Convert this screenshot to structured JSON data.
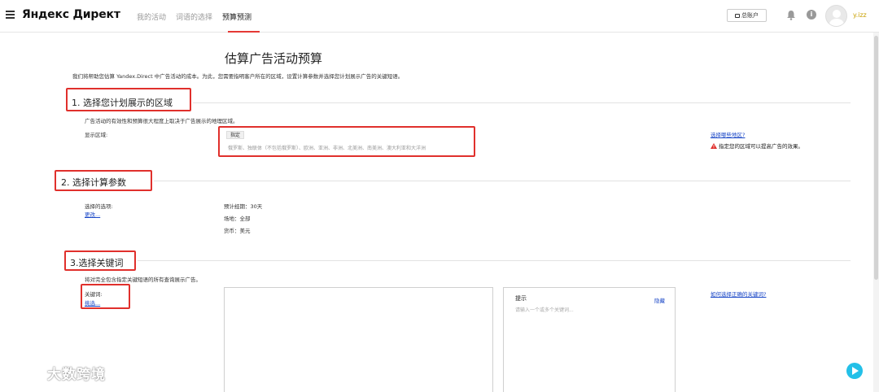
{
  "header": {
    "logo": "Яндекс Директ",
    "nav": [
      {
        "label": "我的活动",
        "active": false
      },
      {
        "label": "词语的选择",
        "active": false
      },
      {
        "label": "预算预测",
        "active": true
      }
    ],
    "account_button": "总账户",
    "username": "y.izz"
  },
  "page": {
    "title": "估算广告活动预算",
    "intro": "我们将帮助您估算 Yandex.Direct 中广告活动的成本。为此，您需要指明客户所在的区域，设置计算参数并选择您计划展示广告的关键短语。"
  },
  "section1": {
    "title": "1. 选择您计划展示的区域",
    "description": "广告活动的有效性和预算很大程度上取决于广告展示的地理区域。",
    "display_label": "显示区域:",
    "tag": "指定",
    "regions": "俄罗斯、独联体（不包括俄罗斯）、欧洲、亚洲、非洲、北美洲、南美洲、澳大利亚和大洋洲",
    "other_link": "选择哪些地区?",
    "warning": "指定您的区域可以提高广告的效果。"
  },
  "section2": {
    "title": "2. 选择计算参数",
    "selected_label": "选择的选项:",
    "change_link": "更改...",
    "period": "预计经期：30天",
    "platform": "场地：全部",
    "currency": "货币：美元"
  },
  "section3": {
    "title": "3.选择关键词",
    "description": "将对完全包含指定关键短语的所有查询展示广告。",
    "keywords_label": "关键词:",
    "pick_link": "挑选...",
    "how_link": "如何选择正确的关键词?",
    "hint_title": "提示",
    "hint_hide": "隐藏",
    "hint_placeholder": "请输入一个或多个关键词..."
  },
  "watermark": "大数跨境",
  "colors": {
    "accent_red": "#e0302c",
    "link_blue": "#1a47c7",
    "username_gold": "#c8a000"
  }
}
